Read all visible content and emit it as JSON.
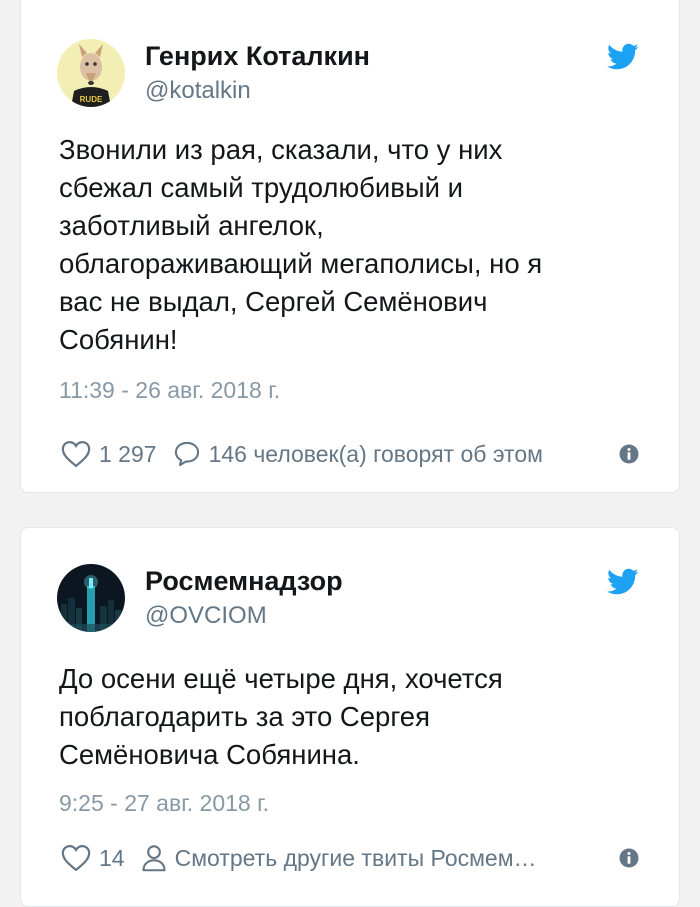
{
  "tweets": [
    {
      "author_name": "Генрих Коталкин",
      "handle": "@kotalkin",
      "avatar_text": "RUDE",
      "text_lines": [
        "Звонили из рая, сказали, что у них",
        "сбежал самый трудолюбивый и",
        "заботливый ангелок,",
        "облагораживающий мегаполисы, но я",
        "вас не выдал, Сергей Семёнович",
        "Собянин!"
      ],
      "timestamp": "11:39 - 26 авг. 2018 г.",
      "likes": "1 297",
      "secondary_action": "146 человек(а) говорят об этом",
      "secondary_icon": "comment-icon"
    },
    {
      "author_name": "Росмемнадзор",
      "handle": "@OVCIOM",
      "text_lines": [
        "До осени ещё четыре дня, хочется",
        "поблагодарить за это Сергея",
        "Семёновича Собянина."
      ],
      "timestamp": "9:25 - 27 авг. 2018 г.",
      "likes": "14",
      "secondary_action": "Смотреть другие твиты Росмем…",
      "secondary_icon": "person-icon"
    }
  ],
  "colors": {
    "background": "#f2f2f2",
    "card": "#ffffff",
    "text": "#14171a",
    "secondary_text": "#657786",
    "timestamp": "#8899a6",
    "twitter_blue": "#1da1f2"
  }
}
